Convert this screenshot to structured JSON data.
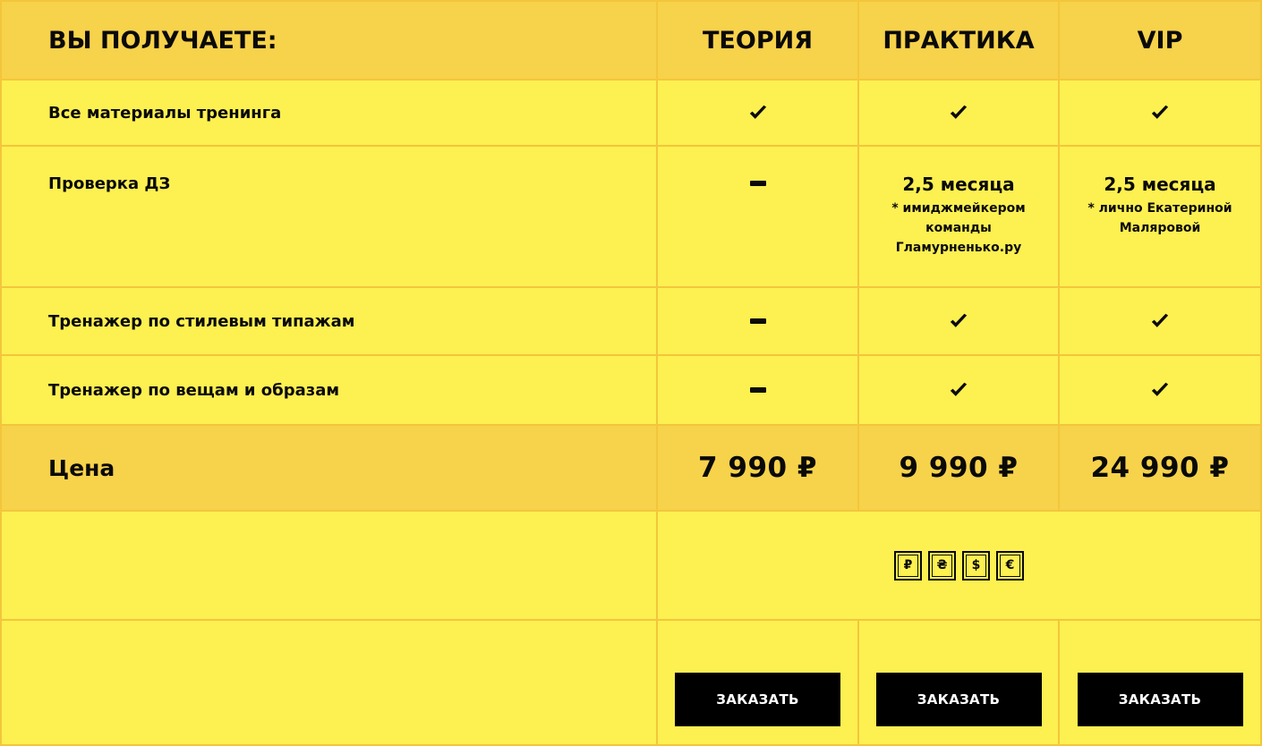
{
  "header": {
    "title": "ВЫ ПОЛУЧАЕТЕ:",
    "plans": [
      "ТЕОРИЯ",
      "ПРАКТИКА",
      "VIP"
    ]
  },
  "rows": [
    {
      "label": "Все материалы тренинга",
      "values": [
        "check-icon",
        "check-icon",
        "check-icon"
      ]
    },
    {
      "label": "Проверка ДЗ",
      "values": [
        "dash-icon",
        "2,5 месяца",
        "2,5 месяца"
      ],
      "notes": [
        "",
        "* имиджмейкером команды Гламурненько.ру",
        "* лично Екатериной Маляровой"
      ]
    },
    {
      "label": "Тренажер по стилевым типажам",
      "values": [
        "dash-icon",
        "check-icon",
        "check-icon"
      ]
    },
    {
      "label": "Тренажер по вещам и образам",
      "values": [
        "dash-icon",
        "check-icon",
        "check-icon"
      ]
    }
  ],
  "price": {
    "label": "Цена",
    "values": [
      "7 990 ₽",
      "9 990 ₽",
      "24 990 ₽"
    ]
  },
  "currencies": [
    "₽",
    "₴",
    "$",
    "€"
  ],
  "order_button": "ЗАКАЗАТЬ",
  "colors": {
    "background": "#fdf051",
    "header": "#f7d24b",
    "border": "#f3c63b",
    "button": "#000000"
  }
}
